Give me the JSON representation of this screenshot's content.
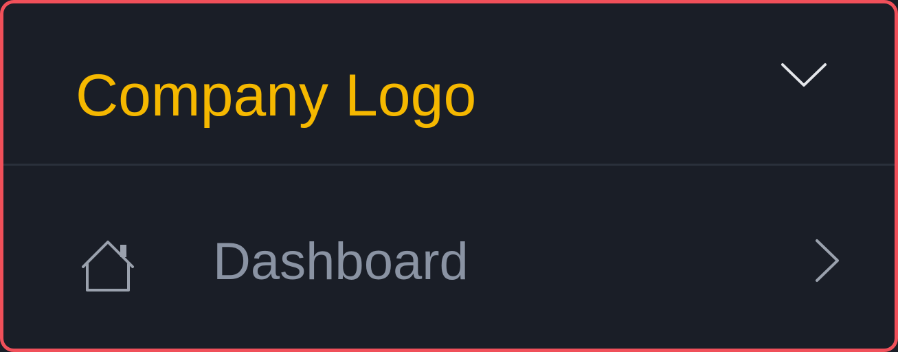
{
  "header": {
    "logo_text": "Company Logo",
    "logo_color": "#f5b800",
    "collapse_icon": "chevron-down-icon"
  },
  "nav": {
    "items": [
      {
        "label": "Dashboard",
        "icon": "home-icon",
        "arrow_icon": "chevron-right-icon"
      }
    ]
  },
  "colors": {
    "background": "#1a1e27",
    "border": "#f0505a",
    "divider": "#2a303b",
    "nav_text": "#8a93a3",
    "icon": "#d5d8de"
  }
}
